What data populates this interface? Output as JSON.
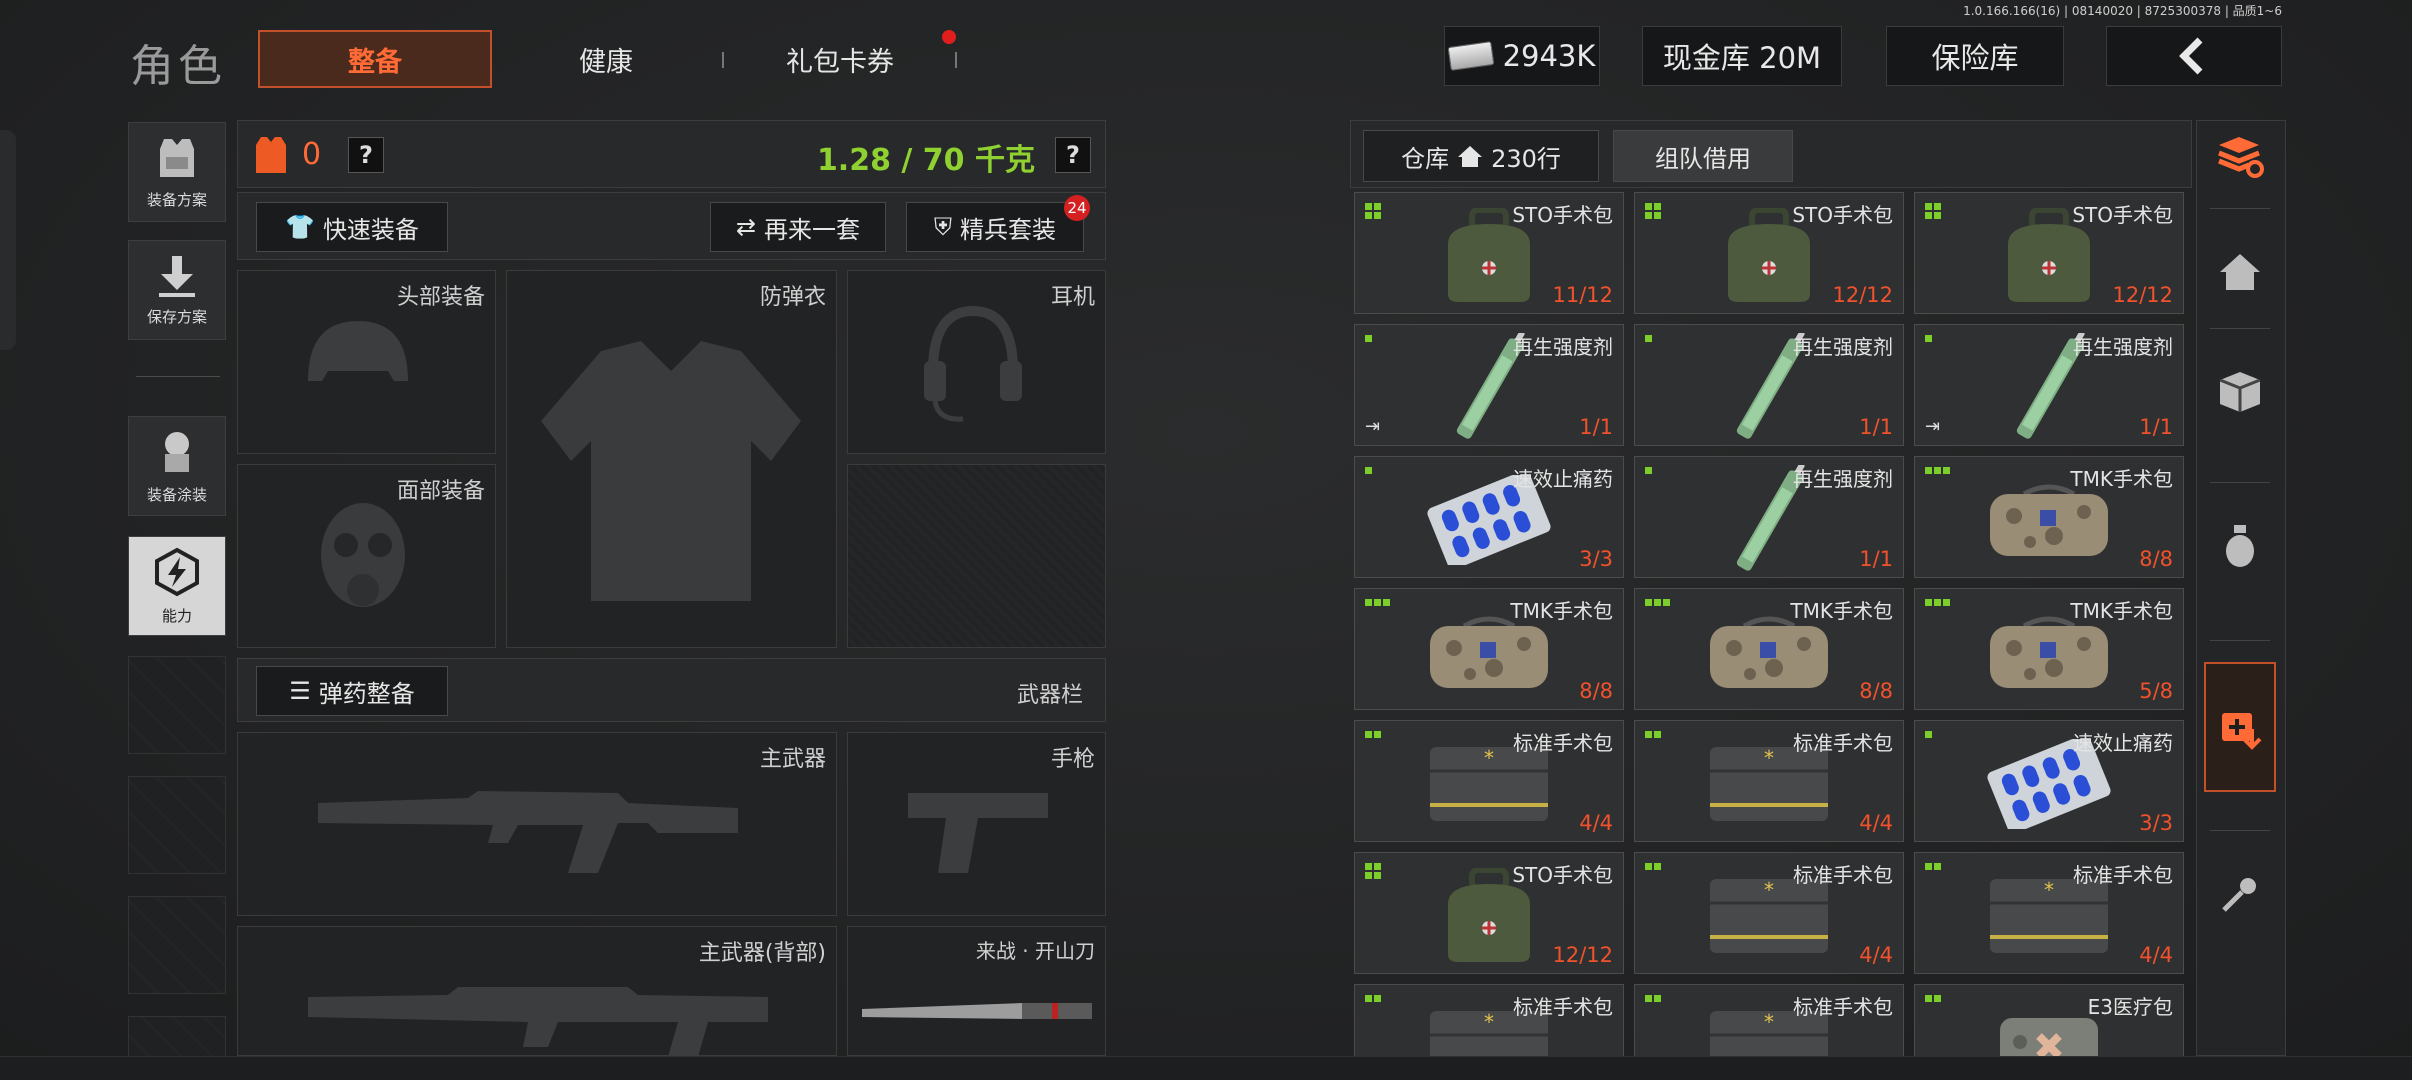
{
  "version": "1.0.166.166(16) | 08140020 | 8725300378 | 品质1~6",
  "page_title": "角色",
  "tabs": [
    {
      "label": "整备",
      "active": true
    },
    {
      "label": "健康",
      "active": false
    },
    {
      "label": "礼包卡券",
      "active": false
    }
  ],
  "top_right": {
    "cash": "2943K",
    "cash_icon": "banknote-stack-icon",
    "vault_label": "现金库 20M",
    "safe_label": "保险库",
    "back_icon": "chevron-left-icon"
  },
  "sidebar": {
    "items": [
      {
        "label": "装备方案",
        "icon": "vest-icon"
      },
      {
        "label": "保存方案",
        "icon": "download-icon"
      },
      {
        "label": "装备涂装",
        "icon": "soldier-icon"
      },
      {
        "label": "能力",
        "icon": "lightning-hex-icon",
        "active": true
      }
    ]
  },
  "loadout": {
    "armor_value": "0",
    "weight": "1.28 / 70 千克",
    "help": "?",
    "quick_equip": "快速装备",
    "again_one_set": "再来一套",
    "elite_kit": "精兵套装",
    "elite_badge": "24",
    "slots": {
      "head": "头部装备",
      "vest": "防弹衣",
      "headset": "耳机",
      "face": "面部装备"
    },
    "ammo_button": "弹药整备",
    "weapon_bar": "武器栏",
    "weapons": {
      "primary": "主武器",
      "pistol": "手枪",
      "primary_back": "主武器(背部)",
      "melee": "来战 · 开山刀"
    }
  },
  "storage": {
    "tab_warehouse": "仓库",
    "tab_rows": "230行",
    "tab_team": "组队借用",
    "items": [
      {
        "name": "STO手术包",
        "count": "11/12",
        "kind": "sto",
        "dots": 4,
        "use": false
      },
      {
        "name": "STO手术包",
        "count": "12/12",
        "kind": "sto",
        "dots": 4,
        "use": false
      },
      {
        "name": "STO手术包",
        "count": "12/12",
        "kind": "sto",
        "dots": 4,
        "use": false
      },
      {
        "name": "再生强度剂",
        "count": "1/1",
        "kind": "syringe",
        "dots": 1,
        "use": true
      },
      {
        "name": "再生强度剂",
        "count": "1/1",
        "kind": "syringe",
        "dots": 1,
        "use": false
      },
      {
        "name": "再生强度剂",
        "count": "1/1",
        "kind": "syringe",
        "dots": 1,
        "use": true
      },
      {
        "name": "速效止痛药",
        "count": "3/3",
        "kind": "pills",
        "dots": 1,
        "use": false
      },
      {
        "name": "再生强度剂",
        "count": "1/1",
        "kind": "syringe",
        "dots": 1,
        "use": false
      },
      {
        "name": "TMK手术包",
        "count": "8/8",
        "kind": "tmk",
        "dots": 3,
        "use": false
      },
      {
        "name": "TMK手术包",
        "count": "8/8",
        "kind": "tmk",
        "dots": 3,
        "use": false
      },
      {
        "name": "TMK手术包",
        "count": "8/8",
        "kind": "tmk",
        "dots": 3,
        "use": false
      },
      {
        "name": "TMK手术包",
        "count": "5/8",
        "kind": "tmk",
        "dots": 3,
        "use": false
      },
      {
        "name": "标准手术包",
        "count": "4/4",
        "kind": "std",
        "dots": 2,
        "use": false
      },
      {
        "name": "标准手术包",
        "count": "4/4",
        "kind": "std",
        "dots": 2,
        "use": false
      },
      {
        "name": "速效止痛药",
        "count": "3/3",
        "kind": "pills",
        "dots": 1,
        "use": false
      },
      {
        "name": "STO手术包",
        "count": "12/12",
        "kind": "sto",
        "dots": 4,
        "use": false
      },
      {
        "name": "标准手术包",
        "count": "4/4",
        "kind": "std",
        "dots": 2,
        "use": false
      },
      {
        "name": "标准手术包",
        "count": "4/4",
        "kind": "std",
        "dots": 2,
        "use": false
      },
      {
        "name": "标准手术包",
        "count": "",
        "kind": "std",
        "dots": 2,
        "use": false
      },
      {
        "name": "标准手术包",
        "count": "",
        "kind": "std",
        "dots": 2,
        "use": false
      },
      {
        "name": "E3医疗包",
        "count": "",
        "kind": "e3",
        "dots": 2,
        "use": false
      }
    ]
  },
  "right_rail": [
    {
      "icon": "layers-refresh-icon",
      "active": false
    },
    {
      "icon": "home-icon",
      "active": false
    },
    {
      "icon": "gear-box-icon",
      "active": false
    },
    {
      "icon": "grenade-icon",
      "active": false
    },
    {
      "icon": "medkit-download-icon",
      "active": true
    },
    {
      "icon": "key-icon",
      "active": false
    }
  ],
  "colors": {
    "accent": "#ff6a36",
    "weight_green": "#8fd130",
    "count_red": "#f0522c",
    "dot_green": "#7ccf2a"
  }
}
